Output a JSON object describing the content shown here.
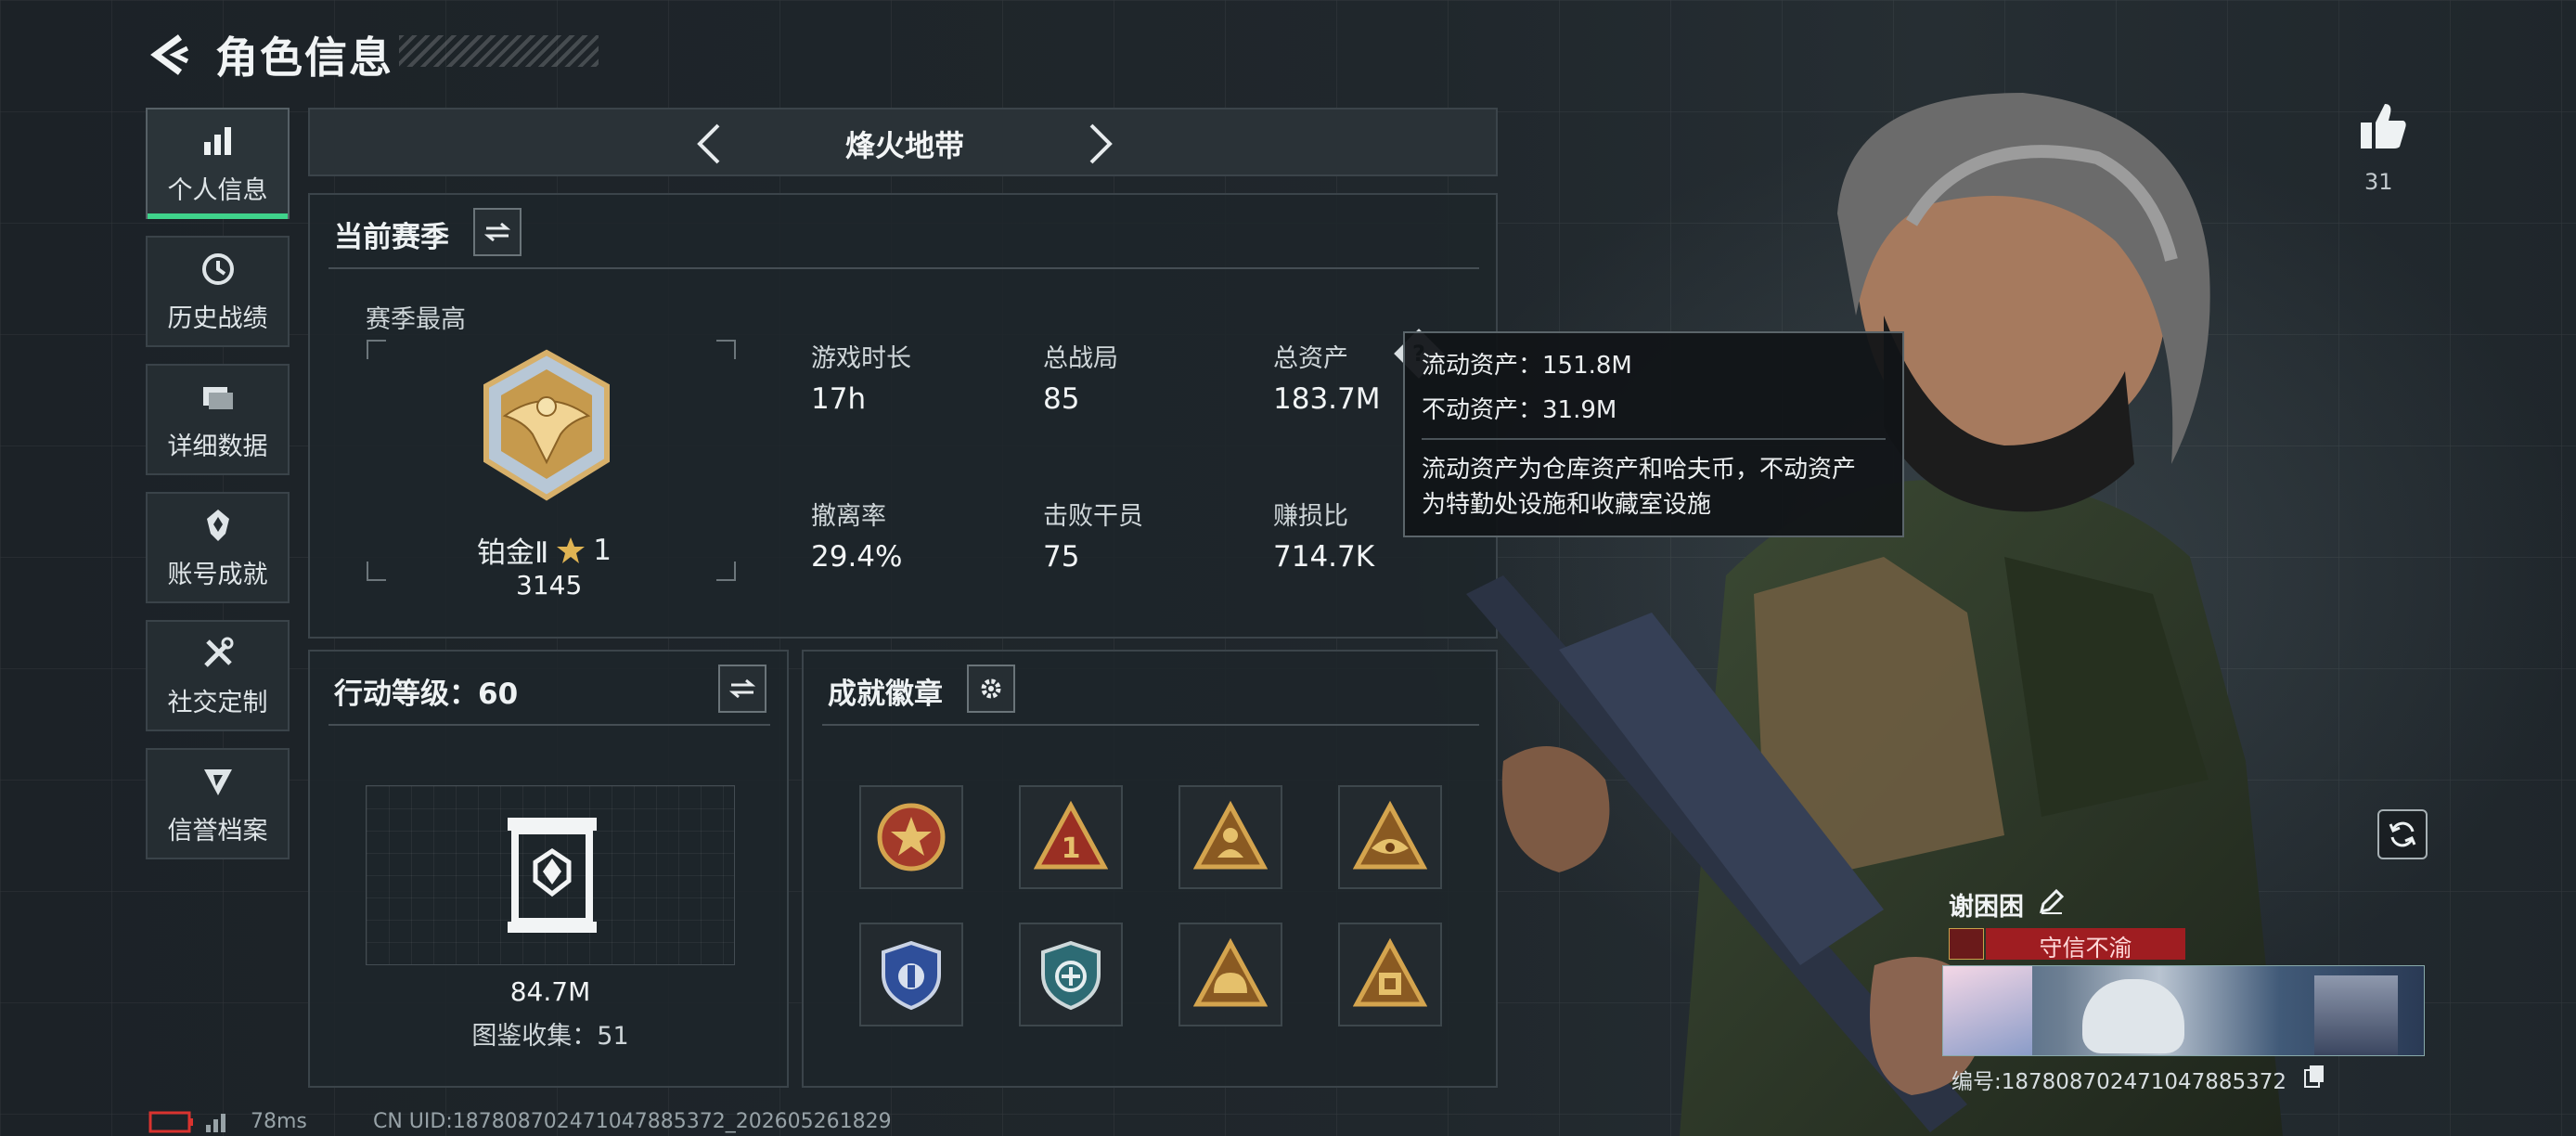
{
  "header": {
    "title": "角色信息"
  },
  "sidebar": {
    "items": [
      {
        "label": "个人信息",
        "icon": "bar-chart-icon",
        "active": true
      },
      {
        "label": "历史战绩",
        "icon": "history-clock-icon",
        "active": false
      },
      {
        "label": "详细数据",
        "icon": "folder-icon",
        "active": false
      },
      {
        "label": "账号成就",
        "icon": "achievement-icon",
        "active": false
      },
      {
        "label": "社交定制",
        "icon": "tools-icon",
        "active": false
      },
      {
        "label": "信誉档案",
        "icon": "credibility-icon",
        "active": false
      }
    ]
  },
  "mode_selector": {
    "label": "烽火地带"
  },
  "season": {
    "title": "当前赛季",
    "best_label": "赛季最高",
    "rank_name": "铂金Ⅱ",
    "rank_stars": "1",
    "rank_score": "3145",
    "stats": [
      {
        "label": "游戏时长",
        "value": "17h"
      },
      {
        "label": "总战局",
        "value": "85"
      },
      {
        "label": "总资产",
        "value": "183.7M"
      },
      {
        "label": "撤离率",
        "value": "29.4%"
      },
      {
        "label": "击败干员",
        "value": "75"
      },
      {
        "label": "赚损比",
        "value": "714.7K"
      }
    ]
  },
  "tooltip": {
    "line1": "流动资产：151.8M",
    "line2": "不动资产：31.9M",
    "desc1": "流动资产为仓库资产和哈夫币，不动资产",
    "desc2": "为特勤处设施和收藏室设施"
  },
  "action_level": {
    "title": "行动等级：60",
    "value": "84.7M",
    "collection": "图鉴收集：51"
  },
  "achievements": {
    "title": "成就徽章",
    "badge_count": 8
  },
  "profile": {
    "likes": "31",
    "name": "谢困困",
    "trust": "守信不渝",
    "uid": "编号:18780870247104788537​2"
  },
  "footer": {
    "ping": "78ms",
    "uid": "CN UID:18780870247104788537​2_202605261829"
  },
  "colors": {
    "accent": "#3fd38b",
    "trust": "#9f1d21",
    "gold": "#c99a4a"
  }
}
